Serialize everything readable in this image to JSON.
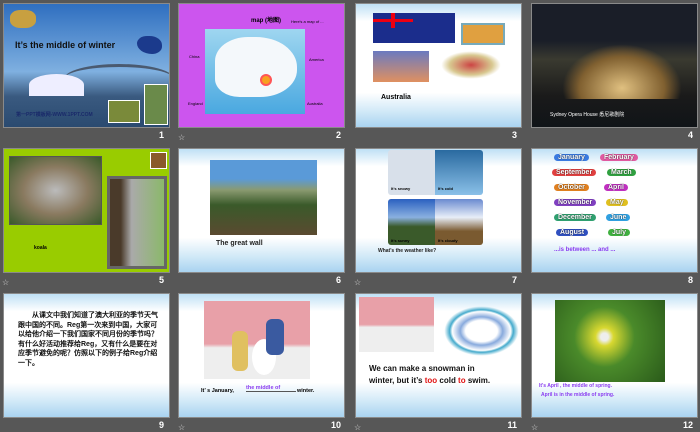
{
  "slides": [
    {
      "number": "1",
      "title": "It’s the middle  of winter",
      "watermark": "第一PPT模板网-WWW.1PPT.COM"
    },
    {
      "number": "2",
      "title": "map (地图)",
      "subtitle": "Here's a map of ...",
      "labels": [
        "China",
        "America",
        "England",
        "Australia"
      ]
    },
    {
      "number": "3",
      "caption": "Australia"
    },
    {
      "number": "4",
      "caption": "Sydney Opera House  悉尼歌剧院"
    },
    {
      "number": "5",
      "caption": "koala"
    },
    {
      "number": "6",
      "caption": "The great wall"
    },
    {
      "number": "7",
      "labels": [
        "It's snowy",
        "It's cold",
        "It's sunny",
        "It's cloudy"
      ],
      "caption": "What's the weather like?"
    },
    {
      "number": "8",
      "months": [
        "January",
        "February",
        "September",
        "March",
        "October",
        "April",
        "November",
        "May",
        "December",
        "June",
        "August",
        "July"
      ],
      "caption": "...is between ... and ..."
    },
    {
      "number": "9",
      "text": "从课文中我们知道了澳大利亚的季节天气跟中国的不同。Reg第一次来到中国，大家可以给他介绍一下我们国家不同月份的季节吗？有什么好活动推荐给Reg，又有什么是要在对应季节避免的呢？仿照以下的例子给Reg介绍一下。"
    },
    {
      "number": "10",
      "before": "It’ s January,",
      "blank": "the middle of",
      "after": "winter."
    },
    {
      "number": "11",
      "line1": "We can make a snowman in",
      "line2a": "winter, but it’s ",
      "too": "too",
      "line2b": " cold ",
      "to": "to",
      "line2c": " swim."
    },
    {
      "number": "12",
      "line1": "It's April , the middle of spring.",
      "line2": "April is in the middle of spring."
    }
  ],
  "colors": {
    "purple": "#8a3cf0",
    "red": "#e01010",
    "green": "#99cc00",
    "magenta": "#cc55ee"
  }
}
